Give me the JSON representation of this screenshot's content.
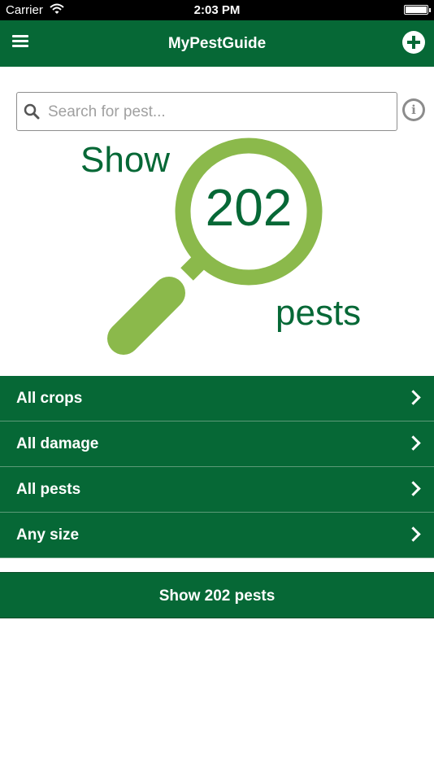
{
  "status_bar": {
    "carrier": "Carrier",
    "time": "2:03 PM"
  },
  "navbar": {
    "title": "MyPestGuide",
    "menu_icon": "hamburger-menu-icon",
    "add_icon": "plus-circle-icon"
  },
  "search": {
    "placeholder": "Search for pest...",
    "value": "",
    "icon": "search-icon",
    "info_icon": "info-icon"
  },
  "hero": {
    "show_word": "Show",
    "count": "202",
    "pests_word": "pests",
    "ring_color": "#8bb94b",
    "text_color": "#066836"
  },
  "filters": [
    {
      "label": "All crops"
    },
    {
      "label": "All damage"
    },
    {
      "label": "All pests"
    },
    {
      "label": "Any size"
    }
  ],
  "show_button": {
    "label": "Show 202 pests"
  },
  "colors": {
    "brand_green": "#066836",
    "accent_green": "#8bb94b"
  }
}
